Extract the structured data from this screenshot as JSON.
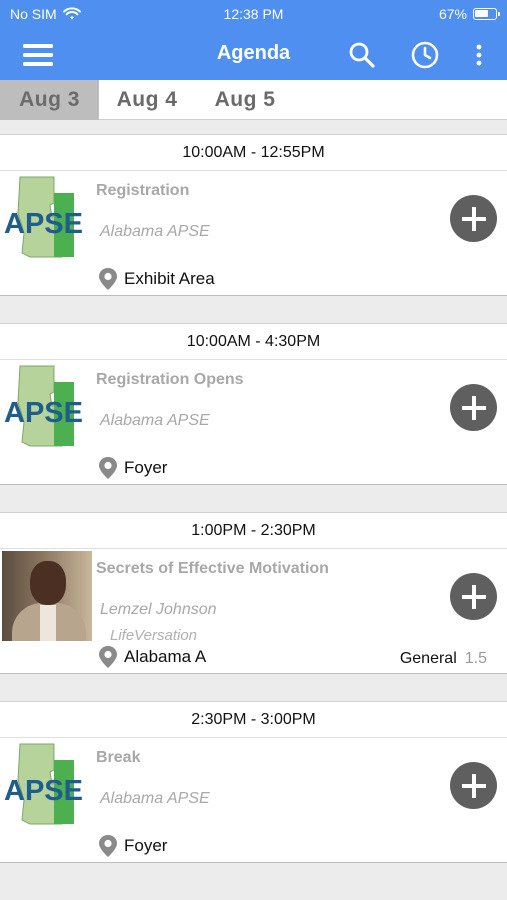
{
  "status": {
    "carrier": "No SIM",
    "time": "12:38 PM",
    "battery": "67%",
    "battery_level": 0.67
  },
  "nav": {
    "title": "Agenda",
    "icons": [
      "menu-icon",
      "search-icon",
      "clock-icon",
      "more-vertical-icon"
    ]
  },
  "dates": [
    {
      "label": "Aug  3",
      "active": true
    },
    {
      "label": "Aug  4",
      "active": false
    },
    {
      "label": "Aug  5",
      "active": false
    }
  ],
  "sessions": [
    {
      "time": "10:00AM - 12:55PM",
      "title": "Registration",
      "organizer": "Alabama APSE",
      "organizer2": "",
      "location": "Exhibit Area",
      "track": "",
      "credits": "",
      "thumb": "apse-logo"
    },
    {
      "time": "10:00AM - 4:30PM",
      "title": "Registration Opens",
      "organizer": "Alabama APSE",
      "organizer2": "",
      "location": "Foyer",
      "track": "",
      "credits": "",
      "thumb": "apse-logo"
    },
    {
      "time": "1:00PM - 2:30PM",
      "title": "Secrets of Effective Motivation",
      "organizer": "Lemzel Johnson",
      "organizer2": "LifeVersation",
      "location": "Alabama A",
      "track": "General",
      "credits": "1.5",
      "thumb": "speaker-photo"
    },
    {
      "time": "2:30PM - 3:00PM",
      "title": "Break",
      "organizer": "Alabama APSE",
      "organizer2": "",
      "location": "Foyer",
      "track": "",
      "credits": "",
      "thumb": "apse-logo"
    }
  ],
  "logo_text": "APSE",
  "colors": {
    "header": "#4f8ff0",
    "logo_blue": "#1f5d8c",
    "logo_green": "#4caf50",
    "state_light": "#b5d39a",
    "add_button": "#5f5f5f"
  }
}
